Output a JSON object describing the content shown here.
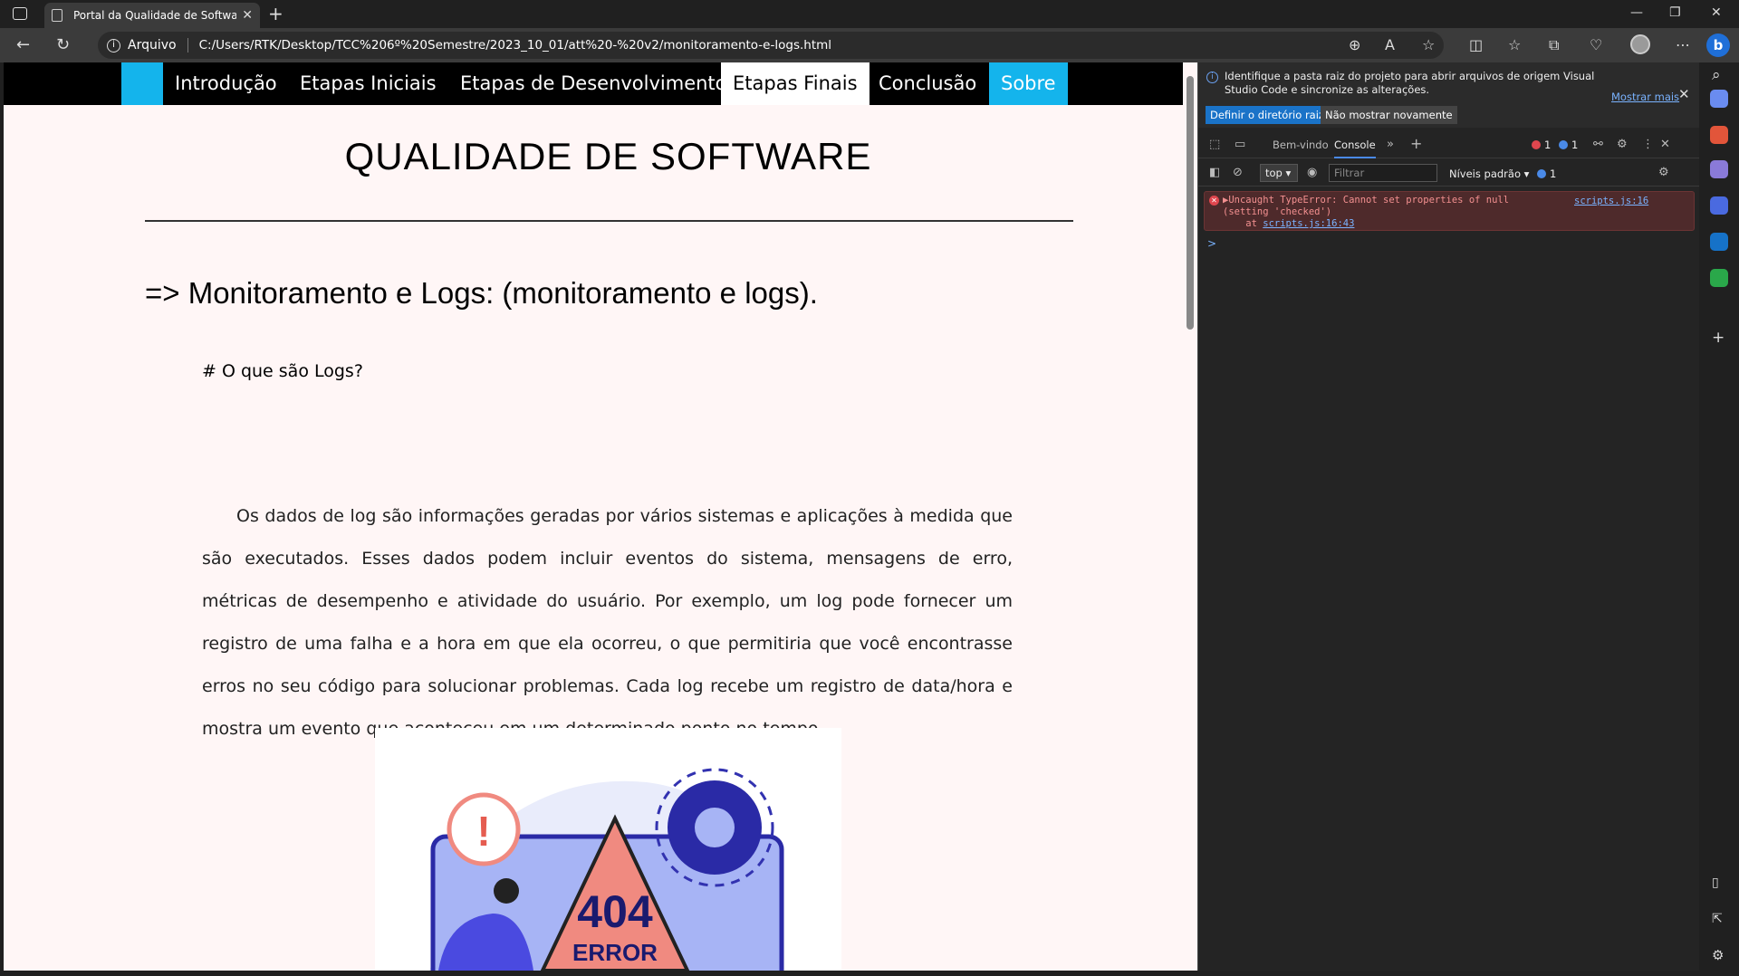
{
  "browser": {
    "tab_title": "Portal da Qualidade de Software",
    "address_label": "Arquivo",
    "url": "C:/Users/RTK/Desktop/TCC%206º%20Semestre/2023_10_01/att%20-%20v2/monitoramento-e-logs.html"
  },
  "page": {
    "nav": [
      {
        "label": "Introdução"
      },
      {
        "label": "Etapas Iniciais"
      },
      {
        "label": "Etapas de Desenvolvimento"
      },
      {
        "label": "Etapas Finais"
      },
      {
        "label": "Conclusão"
      },
      {
        "label": "Sobre"
      }
    ],
    "title": "QUALIDADE DE SOFTWARE",
    "section_heading": "=> Monitoramento e Logs: (monitoramento e logs).",
    "subheading": "# O que são Logs?",
    "paragraph": "Os dados de log são informações geradas por vários sistemas e aplicações à medida que são executados. Esses dados podem incluir eventos do sistema, mensagens de erro, métricas de desempenho e atividade do usuário. Por exemplo, um log pode fornecer um registro de uma falha e a hora em que ela ocorreu, o que permitiria que você encontrasse erros no seu código para solucionar problemas. Cada log recebe um registro de data/hora e mostra um evento que aconteceu em um determinado ponto no tempo.",
    "illustration": {
      "big_text": "404",
      "small_text": "ERROR",
      "alert": "!"
    }
  },
  "devtools": {
    "notification": "Identifique a pasta raiz do projeto para abrir arquivos de origem Visual Studio Code e sincronize as alterações.",
    "show_more": "Mostrar mais",
    "btn_set_root": "Definir o diretório raiz",
    "btn_dont_show": "Não mostrar novamente",
    "tabs": {
      "welcome": "Bem-vindo",
      "console": "Console"
    },
    "error_count": "1",
    "info_count": "1",
    "context": "top",
    "filter_placeholder": "Filtrar",
    "levels": "Níveis padrão",
    "levels_count": "1",
    "error": {
      "line1": "▶Uncaught TypeError: Cannot set properties of null",
      "line2": "(setting 'checked')",
      "at": "    at ",
      "at_link": "scripts.js:16:43",
      "source": "scripts.js:16"
    },
    "prompt": ">"
  },
  "colors": {
    "accent": "#14b4ec",
    "nav_bg": "#000000",
    "page_bg": "#fff6f6",
    "error": "#e0464e"
  }
}
